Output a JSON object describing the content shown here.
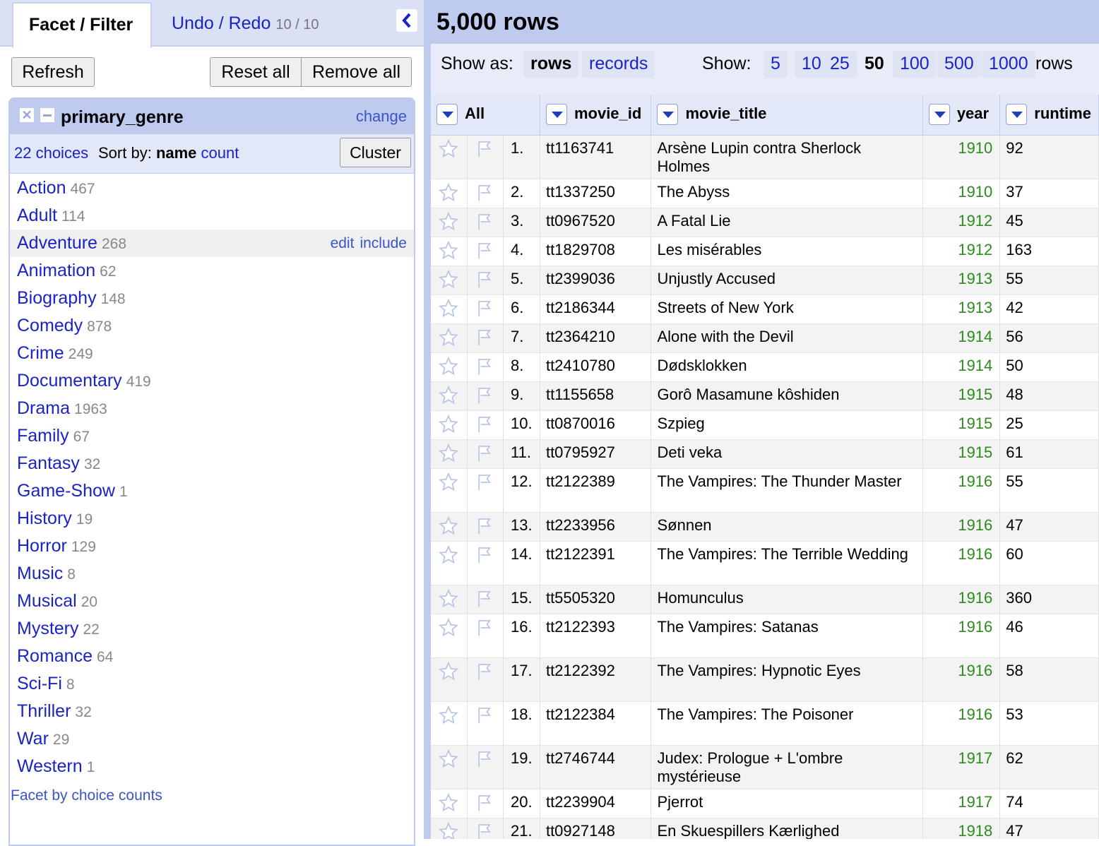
{
  "left_panel": {
    "tabs": {
      "facet": "Facet / Filter",
      "undo": "Undo / Redo",
      "undo_count": "10 / 10"
    },
    "buttons": {
      "refresh": "Refresh",
      "reset_all": "Reset all",
      "remove_all": "Remove all"
    },
    "facet": {
      "title": "primary_genre",
      "change": "change",
      "choices_count": "22 choices",
      "sort_by": "Sort by:",
      "sort_name": "name",
      "sort_count": "count",
      "cluster": "Cluster",
      "choices": [
        {
          "name": "Action",
          "count": "467"
        },
        {
          "name": "Adult",
          "count": "114"
        },
        {
          "name": "Adventure",
          "count": "268"
        },
        {
          "name": "Animation",
          "count": "62"
        },
        {
          "name": "Biography",
          "count": "148"
        },
        {
          "name": "Comedy",
          "count": "878"
        },
        {
          "name": "Crime",
          "count": "249"
        },
        {
          "name": "Documentary",
          "count": "419"
        },
        {
          "name": "Drama",
          "count": "1963"
        },
        {
          "name": "Family",
          "count": "67"
        },
        {
          "name": "Fantasy",
          "count": "32"
        },
        {
          "name": "Game-Show",
          "count": "1"
        },
        {
          "name": "History",
          "count": "19"
        },
        {
          "name": "Horror",
          "count": "129"
        },
        {
          "name": "Music",
          "count": "8"
        },
        {
          "name": "Musical",
          "count": "20"
        },
        {
          "name": "Mystery",
          "count": "22"
        },
        {
          "name": "Romance",
          "count": "64"
        },
        {
          "name": "Sci-Fi",
          "count": "8"
        },
        {
          "name": "Thriller",
          "count": "32"
        },
        {
          "name": "War",
          "count": "29"
        },
        {
          "name": "Western",
          "count": "1"
        }
      ],
      "hover_actions": {
        "edit": "edit",
        "include": "include"
      },
      "facet_by_counts": "Facet by choice counts"
    }
  },
  "right_panel": {
    "row_count": "5,000 rows",
    "show_as_label": "Show as:",
    "show_as_rows": "rows",
    "show_as_records": "records",
    "show_label": "Show:",
    "page_sizes": [
      "5",
      "10",
      "25",
      "50",
      "100",
      "500",
      "1000"
    ],
    "selected_page_size": "50",
    "rows_suffix": "rows",
    "columns": {
      "all": "All",
      "movie_id": "movie_id",
      "movie_title": "movie_title",
      "year": "year",
      "runtime": "runtime"
    },
    "rows": [
      {
        "n": "1.",
        "id": "tt1163741",
        "title": "Arsène Lupin contra Sherlock Holmes",
        "year": "1910",
        "runtime": "92"
      },
      {
        "n": "2.",
        "id": "tt1337250",
        "title": "The Abyss",
        "year": "1910",
        "runtime": "37"
      },
      {
        "n": "3.",
        "id": "tt0967520",
        "title": "A Fatal Lie",
        "year": "1912",
        "runtime": "45"
      },
      {
        "n": "4.",
        "id": "tt1829708",
        "title": "Les misérables",
        "year": "1912",
        "runtime": "163"
      },
      {
        "n": "5.",
        "id": "tt2399036",
        "title": "Unjustly Accused",
        "year": "1913",
        "runtime": "55"
      },
      {
        "n": "6.",
        "id": "tt2186344",
        "title": "Streets of New York",
        "year": "1913",
        "runtime": "42"
      },
      {
        "n": "7.",
        "id": "tt2364210",
        "title": "Alone with the Devil",
        "year": "1914",
        "runtime": "56"
      },
      {
        "n": "8.",
        "id": "tt2410780",
        "title": "Dødsklokken",
        "year": "1914",
        "runtime": "50"
      },
      {
        "n": "9.",
        "id": "tt1155658",
        "title": "Gorô Masamune kôshiden",
        "year": "1915",
        "runtime": "48"
      },
      {
        "n": "10.",
        "id": "tt0870016",
        "title": "Szpieg",
        "year": "1915",
        "runtime": "25"
      },
      {
        "n": "11.",
        "id": "tt0795927",
        "title": "Deti veka",
        "year": "1915",
        "runtime": "61"
      },
      {
        "n": "12.",
        "id": "tt2122389",
        "title": "The Vampires: The Thunder Master",
        "year": "1916",
        "runtime": "55"
      },
      {
        "n": "13.",
        "id": "tt2233956",
        "title": "Sønnen",
        "year": "1916",
        "runtime": "47"
      },
      {
        "n": "14.",
        "id": "tt2122391",
        "title": "The Vampires: The Terrible Wedding",
        "year": "1916",
        "runtime": "60"
      },
      {
        "n": "15.",
        "id": "tt5505320",
        "title": "Homunculus",
        "year": "1916",
        "runtime": "360"
      },
      {
        "n": "16.",
        "id": "tt2122393",
        "title": "The Vampires: Satanas",
        "year": "1916",
        "runtime": "46"
      },
      {
        "n": "17.",
        "id": "tt2122392",
        "title": "The Vampires: Hypnotic Eyes",
        "year": "1916",
        "runtime": "58"
      },
      {
        "n": "18.",
        "id": "tt2122384",
        "title": "The Vampires: The Poisoner",
        "year": "1916",
        "runtime": "53"
      },
      {
        "n": "19.",
        "id": "tt2746744",
        "title": "Judex: Prologue + L'ombre mystérieuse",
        "year": "1917",
        "runtime": "62"
      },
      {
        "n": "20.",
        "id": "tt2239904",
        "title": "Pjerrot",
        "year": "1917",
        "runtime": "74"
      },
      {
        "n": "21.",
        "id": "tt0927148",
        "title": "En Skuespillers Kærlighed",
        "year": "1918",
        "runtime": "47"
      }
    ]
  },
  "colors": {
    "link": "#1a23c6",
    "year_green": "#2e8a1f",
    "header_blue": "#bfcaef",
    "panel_light": "#e3e8f8"
  },
  "icons": {
    "star": "star-icon",
    "flag": "flag-icon",
    "collapse": "chevron-left-icon",
    "close": "close-icon",
    "minimize": "minimize-icon",
    "dropdown": "chevron-down-icon"
  }
}
